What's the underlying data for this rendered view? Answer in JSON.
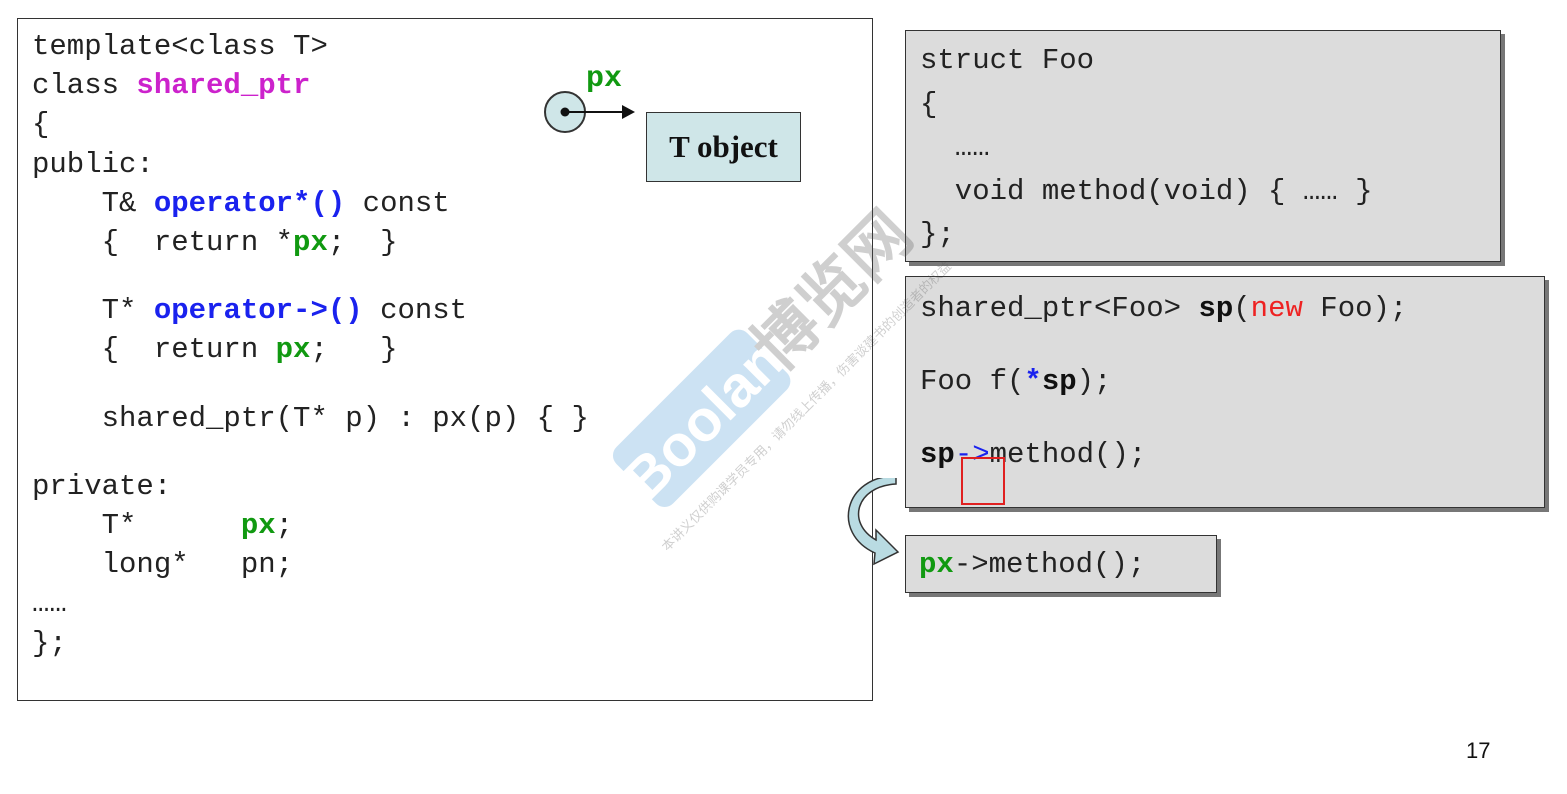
{
  "left_panel": {
    "lines": [
      [
        {
          "t": "template<class T>",
          "c": "plain"
        }
      ],
      [
        {
          "t": "class ",
          "c": "plain"
        },
        {
          "t": "shared_ptr",
          "c": "magenta"
        }
      ],
      [
        {
          "t": "{",
          "c": "plain"
        }
      ],
      [
        {
          "t": "public:",
          "c": "plain"
        }
      ],
      [
        {
          "t": "    T& ",
          "c": "plain"
        },
        {
          "t": "operator*()",
          "c": "blue"
        },
        {
          "t": " const",
          "c": "plain"
        }
      ],
      [
        {
          "t": "    {  return *",
          "c": "plain"
        },
        {
          "t": "px",
          "c": "green"
        },
        {
          "t": ";  }",
          "c": "plain"
        }
      ],
      [
        {
          "t": "",
          "c": "plain"
        }
      ],
      [
        {
          "t": "    T* ",
          "c": "plain"
        },
        {
          "t": "operator->()",
          "c": "blue"
        },
        {
          "t": " const",
          "c": "plain"
        }
      ],
      [
        {
          "t": "    {  return ",
          "c": "plain"
        },
        {
          "t": "px",
          "c": "green"
        },
        {
          "t": ";   }",
          "c": "plain"
        }
      ],
      [
        {
          "t": "",
          "c": "plain"
        }
      ],
      [
        {
          "t": "    shared_ptr(T* p) : px(p) { }",
          "c": "plain"
        }
      ],
      [
        {
          "t": "",
          "c": "plain"
        }
      ],
      [
        {
          "t": "private:",
          "c": "plain"
        }
      ],
      [
        {
          "t": "    T*      ",
          "c": "plain"
        },
        {
          "t": "px",
          "c": "green"
        },
        {
          "t": ";",
          "c": "plain"
        }
      ],
      [
        {
          "t": "    long*   pn;",
          "c": "plain"
        }
      ],
      [
        {
          "t": "……",
          "c": "plain"
        }
      ],
      [
        {
          "t": "};",
          "c": "plain"
        }
      ]
    ]
  },
  "diagram": {
    "pointer_label": "px",
    "object_label": "T object"
  },
  "struct_box": {
    "lines": [
      [
        {
          "t": "struct Foo",
          "c": "plain"
        }
      ],
      [
        {
          "t": "{",
          "c": "plain"
        }
      ],
      [
        {
          "t": "  ……",
          "c": "plain"
        }
      ],
      [
        {
          "t": "  void method(void) { …… }",
          "c": "plain"
        }
      ],
      [
        {
          "t": "};",
          "c": "plain"
        }
      ]
    ]
  },
  "usage_box": {
    "lines": [
      [
        {
          "t": "shared_ptr<Foo> ",
          "c": "plain"
        },
        {
          "t": "sp",
          "c": "bold"
        },
        {
          "t": "(",
          "c": "plain"
        },
        {
          "t": "new",
          "c": "red"
        },
        {
          "t": " Foo);",
          "c": "plain"
        }
      ],
      [
        {
          "t": "",
          "c": "plain"
        }
      ],
      [
        {
          "t": "Foo f(",
          "c": "plain"
        },
        {
          "t": "*",
          "c": "blue"
        },
        {
          "t": "sp",
          "c": "bold"
        },
        {
          "t": ");",
          "c": "plain"
        }
      ],
      [
        {
          "t": "",
          "c": "plain"
        }
      ],
      [
        {
          "t": "sp",
          "c": "bold"
        },
        {
          "t": "->",
          "c": "bluenb"
        },
        {
          "t": "method();",
          "c": "plain"
        }
      ]
    ]
  },
  "result_box": {
    "lines": [
      [
        {
          "t": "px",
          "c": "green"
        },
        {
          "t": "->method();",
          "c": "plain"
        }
      ]
    ]
  },
  "watermark": {
    "brand": "Boolan",
    "chinese": "博览网",
    "notice": "本讲义仅供购课学员专用，请勿线上传播，伤害谈建书的创造者的权益"
  },
  "page_number": "17",
  "colors": {
    "magenta": "#cc22cc",
    "blue": "#1a22ee",
    "green": "#119911",
    "red": "#ee2222",
    "box_gray": "#dcdcdc",
    "object_box": "#cfe6e8",
    "highlight": "#e02020"
  }
}
